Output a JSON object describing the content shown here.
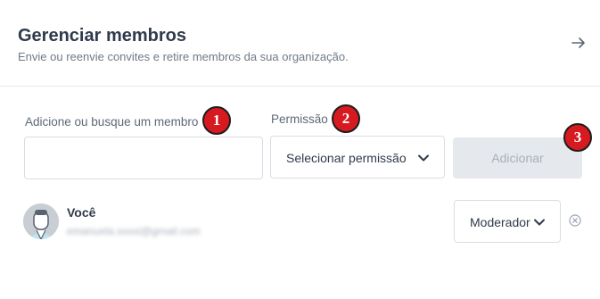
{
  "header": {
    "title": "Gerenciar membros",
    "subtitle": "Envie ou reenvie convites e retire membros da sua organização.",
    "arrow_icon": "arrow-right-icon"
  },
  "form": {
    "member_label": "Adicione ou busque um membro",
    "member_value": "",
    "permission_label": "Permissão",
    "permission_value": "Selecionar permissão",
    "add_label": "Adicionar"
  },
  "badges": [
    "1",
    "2",
    "3"
  ],
  "members": [
    {
      "name": "Você",
      "email": "emanuela.xxxxi@gmail.com",
      "role": "Moderador",
      "remove_icon": "remove-circle-x-icon"
    }
  ],
  "colors": {
    "badge": "#d71920",
    "button_disabled_bg": "#e5e8ec",
    "button_disabled_text": "#a8b0ba",
    "accent_icon": "#9aa4b1"
  }
}
